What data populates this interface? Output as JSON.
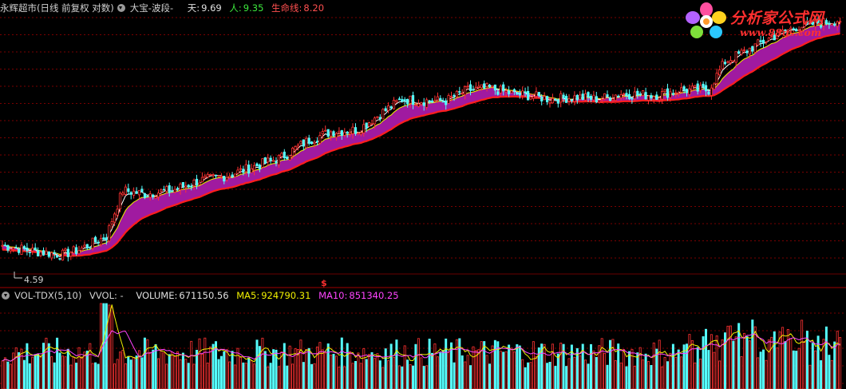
{
  "header": {
    "title": "永辉超市(日线 前复权 对数)",
    "indicator": "大宝-波段-",
    "sky_label": "天:",
    "sky_value": "9.69",
    "human_label": "人:",
    "human_value": "9.35",
    "life_label": "生命线:",
    "life_value": "8.20"
  },
  "vol_header": {
    "name": "VOL-TDX(5,10)",
    "vvol": "VVOL: -",
    "volume_label": "VOLUME:",
    "volume_value": "671150.56",
    "ma5_label": "MA5:",
    "ma5_value": "924790.31",
    "ma10_label": "MA10:",
    "ma10_value": "851340.25"
  },
  "logo": {
    "text": "分析家公式网",
    "sub": "www.88gs.com"
  },
  "markers": {
    "low_label": "4.59",
    "dollar": "$"
  },
  "colors": {
    "up": "#ff3232",
    "down": "#54fcfc",
    "band": "#a01aa0",
    "life_line": "#ff1e1e",
    "human_line": "#f0f000",
    "sky_line": "#ffffff",
    "grid": "#7a0000",
    "header_red": "#ff5050",
    "header_green": "#3ce83c",
    "ma5": "#f0f000",
    "ma10": "#ff44ff"
  },
  "chart_data": [
    {
      "type": "candlestick",
      "title": "永辉超市(日线 前复权 对数)",
      "scale": "log",
      "ylim": [
        4.3,
        10.6
      ],
      "grid": true,
      "anchors": [
        [
          0,
          4.75
        ],
        [
          12,
          4.65
        ],
        [
          22,
          4.6
        ],
        [
          28,
          4.68
        ],
        [
          38,
          4.9
        ],
        [
          44,
          5.75
        ],
        [
          52,
          5.68
        ],
        [
          62,
          5.75
        ],
        [
          72,
          5.95
        ],
        [
          82,
          6.05
        ],
        [
          92,
          6.25
        ],
        [
          102,
          6.45
        ],
        [
          112,
          6.85
        ],
        [
          120,
          7.05
        ],
        [
          130,
          7.1
        ],
        [
          138,
          7.5
        ],
        [
          146,
          7.9
        ],
        [
          152,
          7.85
        ],
        [
          162,
          7.85
        ],
        [
          170,
          8.15
        ],
        [
          178,
          8.2
        ],
        [
          186,
          8.05
        ],
        [
          192,
          8.0
        ],
        [
          200,
          7.9
        ],
        [
          210,
          7.95
        ],
        [
          218,
          7.9
        ],
        [
          226,
          8.05
        ],
        [
          238,
          8.0
        ],
        [
          248,
          8.15
        ],
        [
          258,
          8.15
        ],
        [
          264,
          9.0
        ],
        [
          272,
          9.35
        ],
        [
          280,
          9.75
        ],
        [
          290,
          10.15
        ],
        [
          300,
          10.3
        ],
        [
          306,
          10.4
        ]
      ],
      "series": [
        {
          "name": "天",
          "last": 9.69
        },
        {
          "name": "人",
          "last": 9.35
        },
        {
          "name": "生命线",
          "last": 8.2
        }
      ],
      "annotations": [
        {
          "label": "4.59",
          "value": 4.59
        }
      ]
    },
    {
      "type": "bar",
      "title": "VOL-TDX(5,10)",
      "series": [
        {
          "name": "VOLUME",
          "last": 671150.56
        },
        {
          "name": "MA5",
          "last": 924790.31
        },
        {
          "name": "MA10",
          "last": 851340.25
        }
      ]
    }
  ]
}
